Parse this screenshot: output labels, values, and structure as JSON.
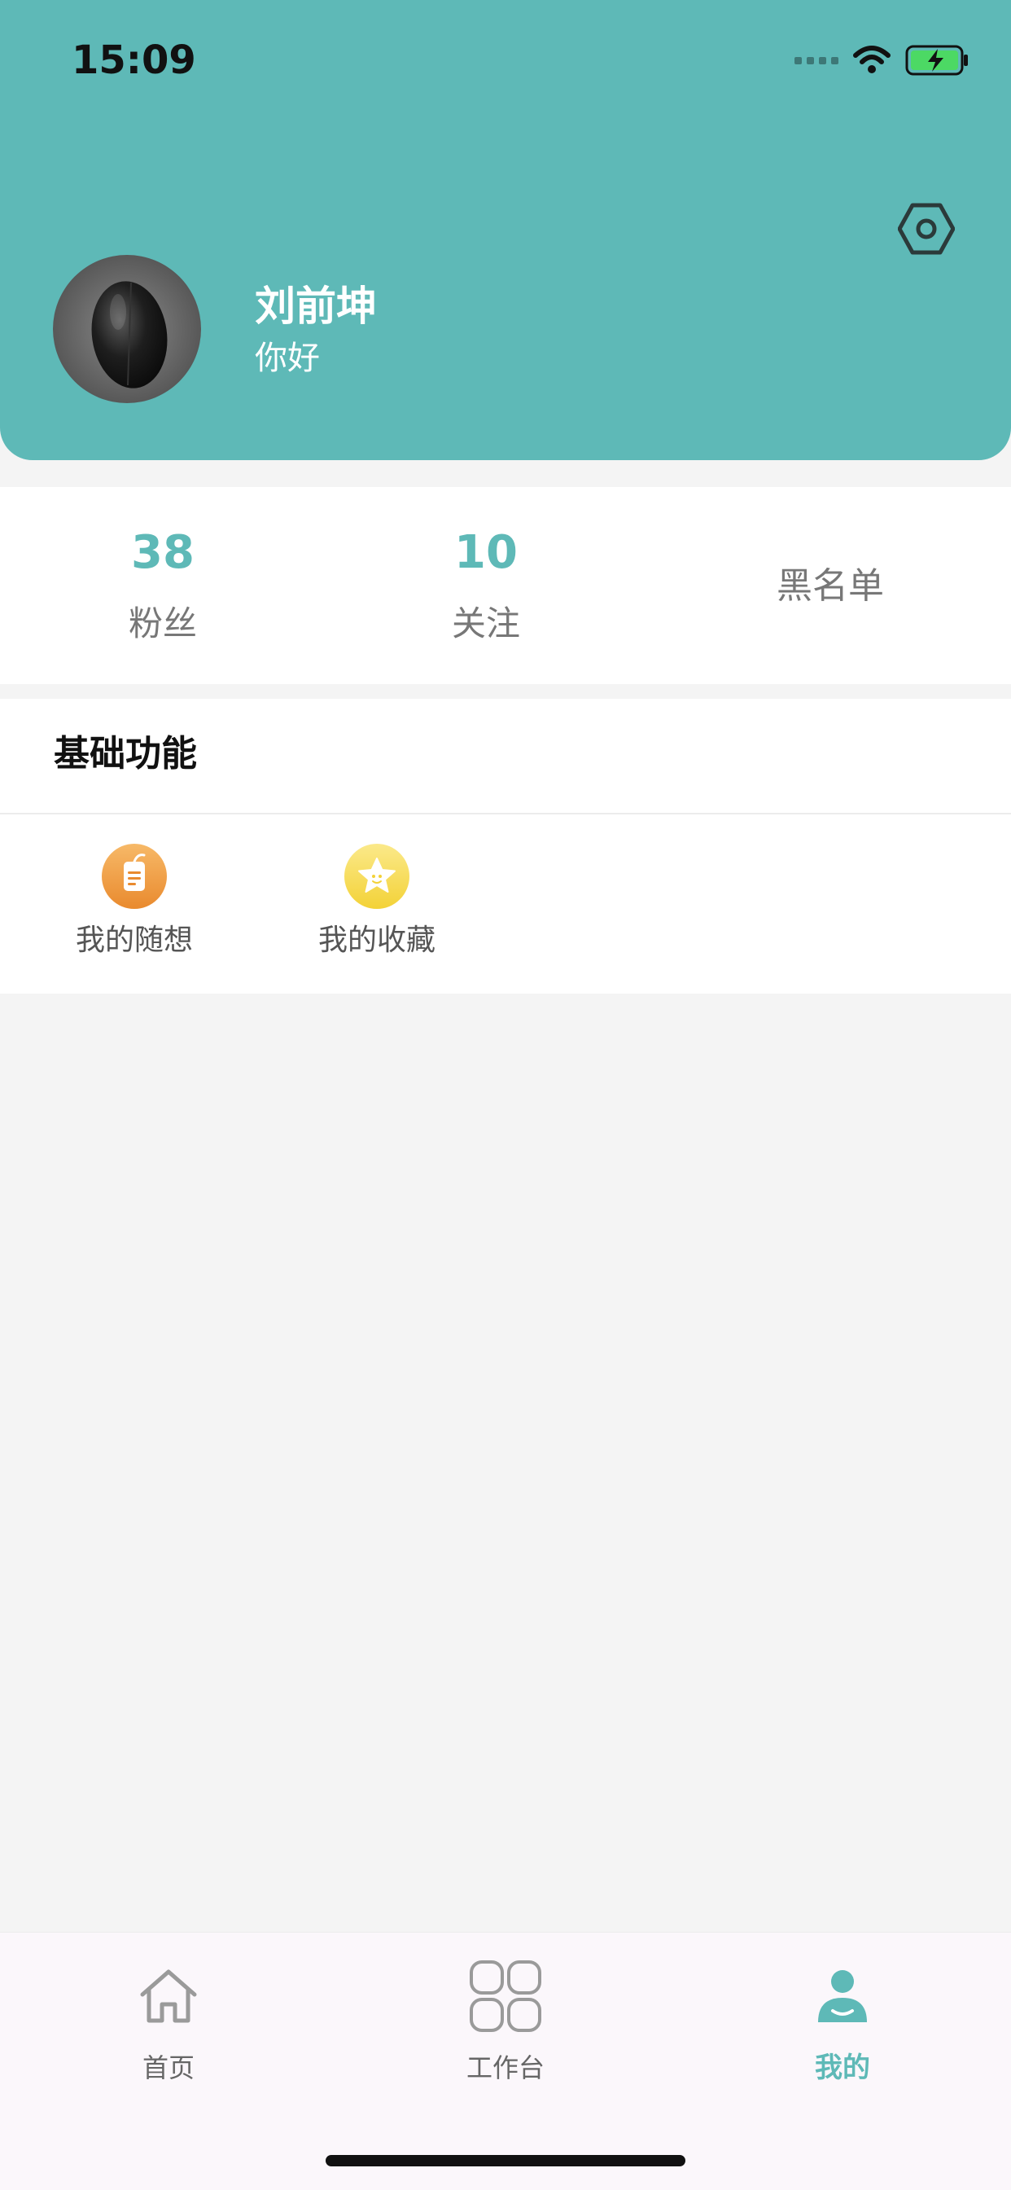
{
  "status_bar": {
    "time": "15:09"
  },
  "profile": {
    "name": "刘前坤",
    "greeting": "你好"
  },
  "stats": [
    {
      "value": "38",
      "label": "粉丝"
    },
    {
      "value": "10",
      "label": "关注"
    },
    {
      "label": "黑名单"
    }
  ],
  "features": {
    "title": "基础功能",
    "items": [
      {
        "label": "我的随想",
        "icon": "note-icon",
        "color": "#f0a24a"
      },
      {
        "label": "我的收藏",
        "icon": "star-icon",
        "color": "#f5d84a"
      }
    ]
  },
  "tabbar": {
    "items": [
      {
        "label": "首页",
        "icon": "home-icon",
        "active": false
      },
      {
        "label": "工作台",
        "icon": "grid-icon",
        "active": false
      },
      {
        "label": "我的",
        "icon": "profile-icon",
        "active": true
      }
    ]
  },
  "colors": {
    "accent": "#5eb9b7",
    "background": "#f4f4f4"
  }
}
